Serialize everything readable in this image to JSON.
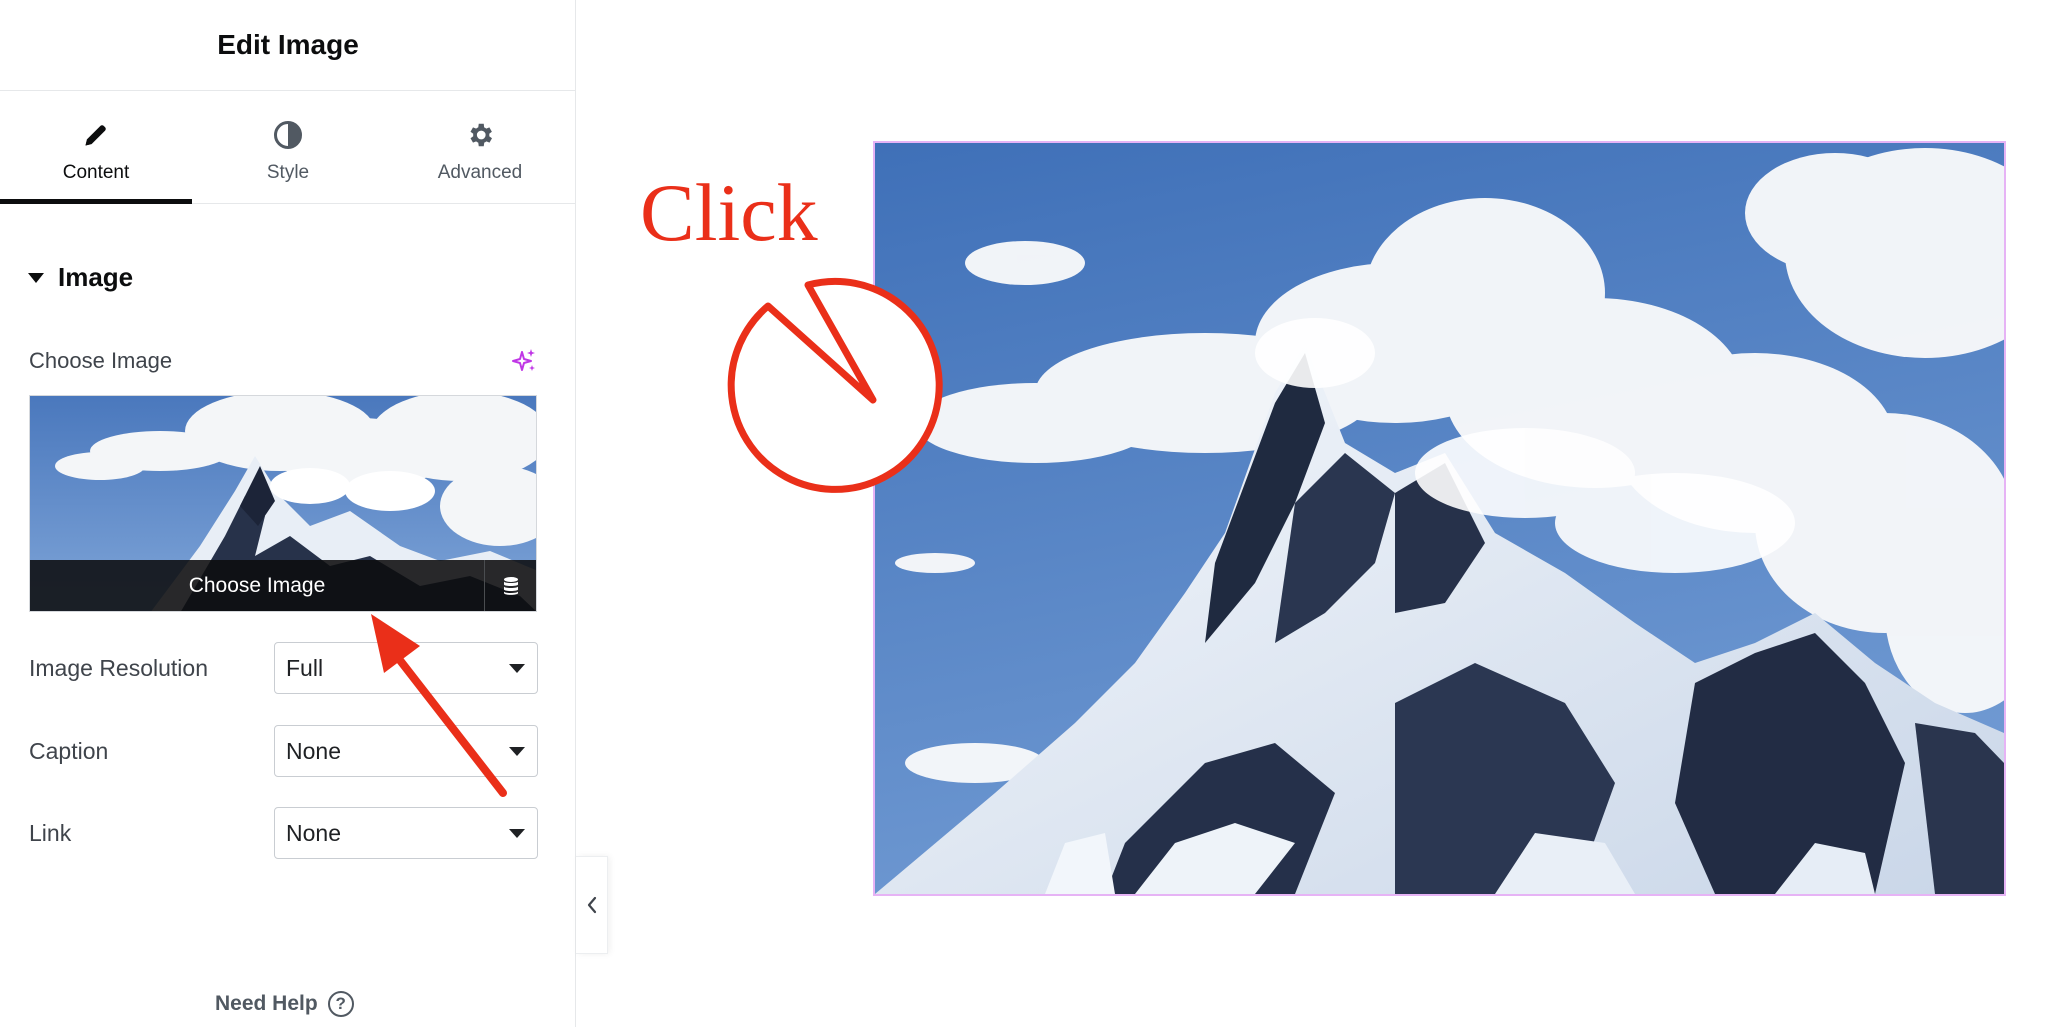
{
  "panel": {
    "title": "Edit Image",
    "tabs": [
      {
        "label": "Content",
        "icon": "pencil-icon",
        "active": true
      },
      {
        "label": "Style",
        "icon": "contrast-icon",
        "active": false
      },
      {
        "label": "Advanced",
        "icon": "gear-icon",
        "active": false
      }
    ],
    "section_title": "Image",
    "choose_image_label": "Choose Image",
    "ai_icon": "sparkle-icon",
    "choose_button_label": "Choose Image",
    "library_icon": "database-icon",
    "fields": {
      "resolution": {
        "label": "Image Resolution",
        "value": "Full"
      },
      "caption": {
        "label": "Caption",
        "value": "None"
      },
      "link": {
        "label": "Link",
        "value": "None"
      }
    },
    "need_help_label": "Need Help",
    "help_icon": "question-circle-icon",
    "collapse_icon": "chevron-left-icon"
  },
  "annotation": {
    "callout_text": "Click",
    "color": "#ea2f19"
  },
  "colors": {
    "accent_tab": "#0c0d0e",
    "ai_icon": "#c036e6",
    "selection_border": "#e6b3f5"
  }
}
